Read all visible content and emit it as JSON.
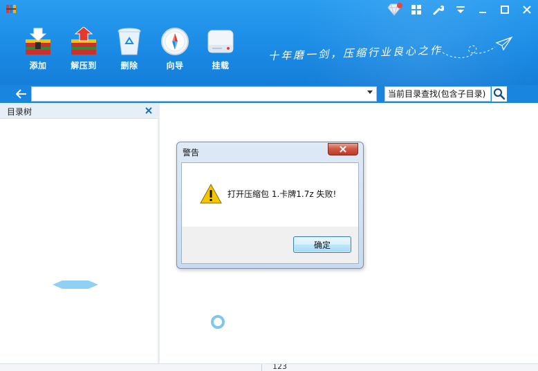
{
  "window": {
    "controls": [
      "skin-icon",
      "grid-icon",
      "wrench-icon",
      "menu-dropdown-icon",
      "minimize-icon",
      "maximize-icon",
      "close-icon"
    ]
  },
  "toolbar": {
    "items": [
      {
        "label": "添加",
        "icon": "add-archive-icon"
      },
      {
        "label": "解压到",
        "icon": "extract-icon"
      },
      {
        "label": "删除",
        "icon": "recycle-bin-icon"
      },
      {
        "label": "向导",
        "icon": "compass-icon"
      },
      {
        "label": "挂载",
        "icon": "disk-drive-icon"
      }
    ]
  },
  "slogan": "十年磨一剑，压缩行业良心之作",
  "addressbar": {
    "path_value": "",
    "search_placeholder": "当前目录查找(包含子目录)"
  },
  "tree": {
    "title": "目录树"
  },
  "dialog": {
    "title": "警告",
    "message": "打开压缩包 1.卡牌1.7z 失败!",
    "ok_label": "确定"
  },
  "statusbar": {
    "text": "123"
  },
  "colors": {
    "header_blue": "#1a8ae4",
    "accent_light_blue": "#a7d9f5",
    "warning_yellow": "#f5c400",
    "close_red": "#c03a24"
  }
}
